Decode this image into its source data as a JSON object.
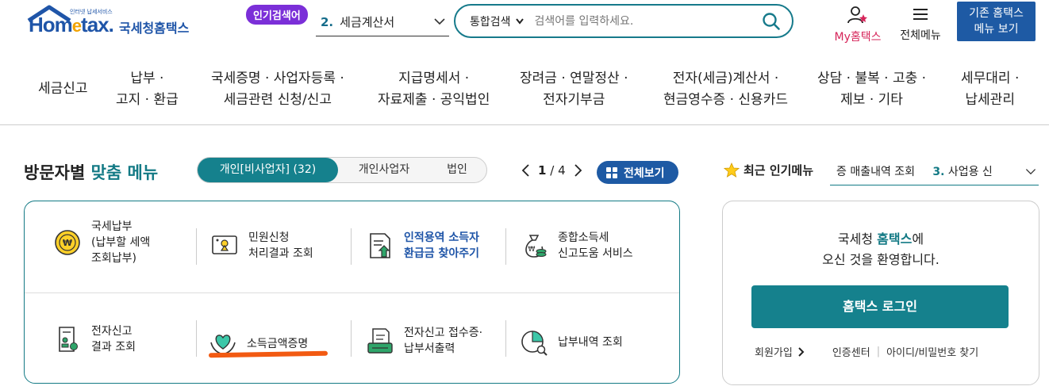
{
  "header": {
    "logo_small": "인터넷 납세서비스",
    "logo_main_a": "Hom",
    "logo_main_e": "e",
    "logo_main_b": "tax.",
    "logo_kr": "국세청홈택스",
    "popular_badge": "인기검색어",
    "popular_num": "2.",
    "popular_term": "세금계산서",
    "search_scope": "통합검색",
    "search_placeholder": "검색어를 입력하세요.",
    "my_label": "My홈택스",
    "allmenu_label": "전체메뉴",
    "legacy_line1": "기존 홈택스",
    "legacy_line2": "메뉴 보기"
  },
  "gnb": [
    {
      "l1": "세금신고",
      "l2": ""
    },
    {
      "l1": "납부 ·",
      "l2": "고지 · 환급"
    },
    {
      "l1": "국세증명 · 사업자등록 ·",
      "l2": "세금관련 신청/신고"
    },
    {
      "l1": "지급명세서 ·",
      "l2": "자료제출 · 공익법인"
    },
    {
      "l1": "장려금 · 연말정산 ·",
      "l2": "전자기부금"
    },
    {
      "l1": "전자(세금)계산서 ·",
      "l2": "현금영수증 · 신용카드"
    },
    {
      "l1": "상담 · 불복 · 고충 ·",
      "l2": "제보 · 기타"
    },
    {
      "l1": "세무대리 ·",
      "l2": "납세관리"
    }
  ],
  "visitor": {
    "title_a": "방문자별",
    "title_b": "맞춤 메뉴",
    "tabs": [
      "개인[비사업자] (32)",
      "개인사업자",
      "법인"
    ],
    "page_current": "1",
    "page_sep": "/",
    "page_total": "4",
    "view_all": "전체보기"
  },
  "menu_items": [
    {
      "lines": [
        "국세납부",
        "(납부할 세액",
        "조회납부)"
      ],
      "icon": "won-coin-icon"
    },
    {
      "lines": [
        "민원신청",
        "처리결과 조회"
      ],
      "icon": "certificate-monitor-icon"
    },
    {
      "lines": [
        "인적용역 소득자",
        "환급금 찾아주기"
      ],
      "icon": "refund-document-icon"
    },
    {
      "lines": [
        "종합소득세",
        "신고도움 서비스"
      ],
      "icon": "money-bag-icon"
    },
    {
      "lines": [
        "전자신고",
        "결과 조회"
      ],
      "icon": "stamp-document-icon"
    },
    {
      "lines": [
        "소득금액증명"
      ],
      "icon": "heart-hands-icon"
    },
    {
      "lines": [
        "전자신고 접수증·",
        "납부서출력"
      ],
      "icon": "printer-document-icon"
    },
    {
      "lines": [
        "납부내역 조회"
      ],
      "icon": "pie-chart-search-icon"
    }
  ],
  "popular_menu": {
    "title": "최근 인기메뉴",
    "item_tail": "증 매출내역 조회",
    "next_num": "3.",
    "next_text": "사업용 신"
  },
  "login": {
    "welcome_a": "국세청 ",
    "welcome_b": "홈택스",
    "welcome_c": "에",
    "welcome_line2": "오신 것을 환영합니다.",
    "button": "홈택스 로그인",
    "signup": "회원가입",
    "cert_center": "인증센터",
    "sep": "|",
    "find_id": "아이디/비밀번호 찾기"
  },
  "colors": {
    "teal": "#15818d",
    "blue": "#1e5aa4",
    "purple": "#7b2fd8",
    "pink": "#d6255a",
    "highlight": "#f25a12"
  }
}
